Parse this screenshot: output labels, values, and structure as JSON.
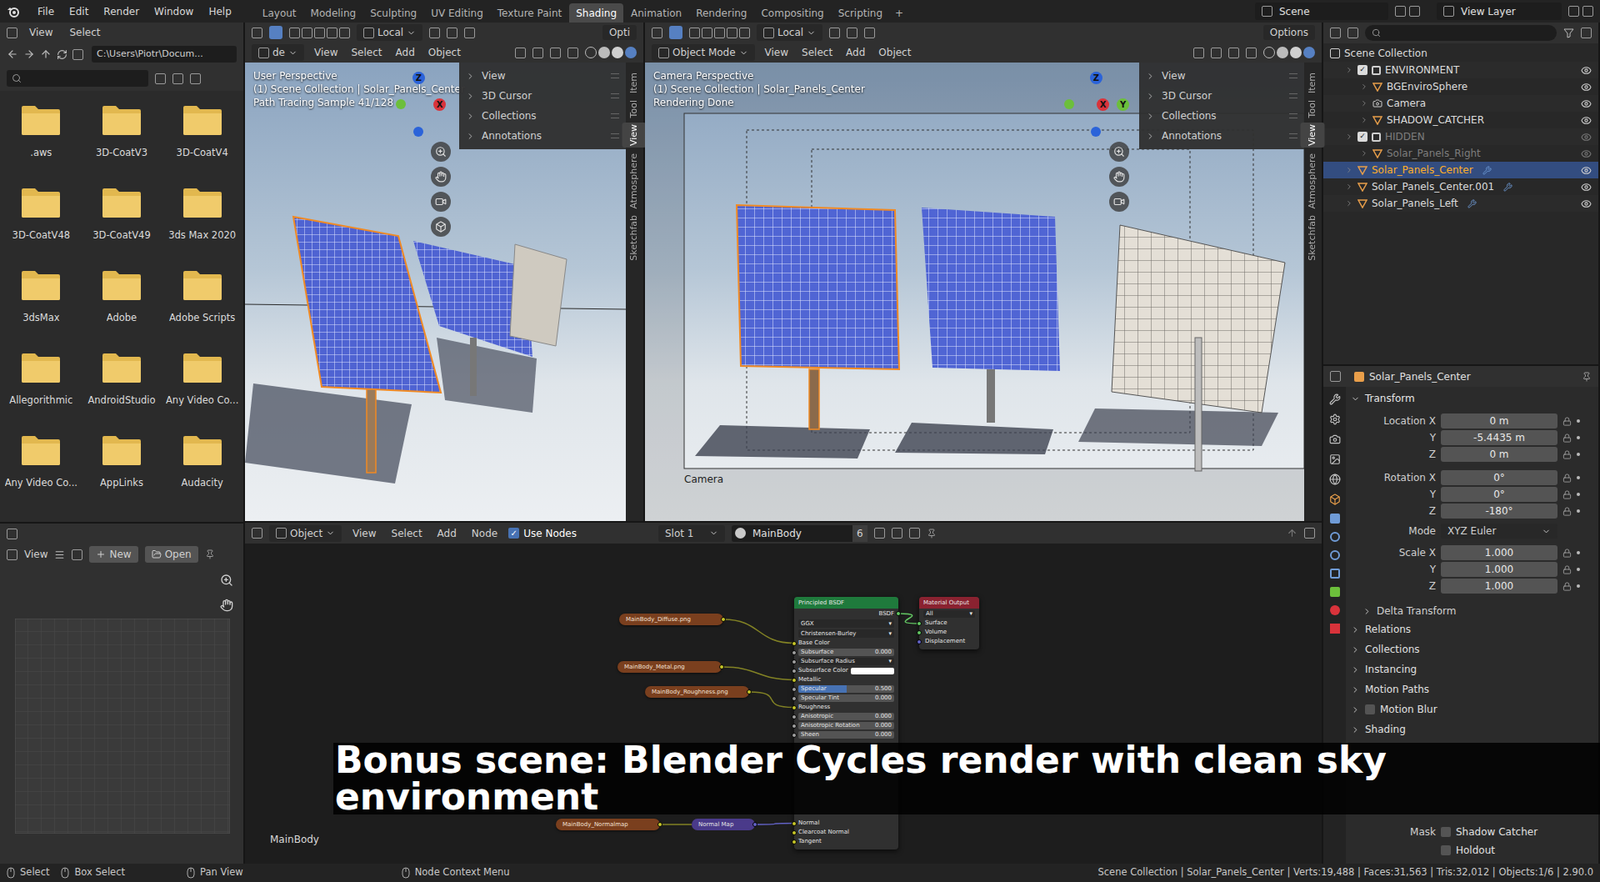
{
  "topbar": {
    "menus": [
      "File",
      "Edit",
      "Render",
      "Window",
      "Help"
    ],
    "workspaces": [
      {
        "label": "Layout",
        "selected": false
      },
      {
        "label": "Modeling",
        "selected": false
      },
      {
        "label": "Sculpting",
        "selected": false
      },
      {
        "label": "UV Editing",
        "selected": false
      },
      {
        "label": "Texture Paint",
        "selected": false
      },
      {
        "label": "Shading",
        "selected": true
      },
      {
        "label": "Animation",
        "selected": false
      },
      {
        "label": "Rendering",
        "selected": false
      },
      {
        "label": "Compositing",
        "selected": false
      },
      {
        "label": "Scripting",
        "selected": false
      }
    ],
    "add_tab": "+",
    "scene": "Scene",
    "view_layer": "View Layer"
  },
  "file_browser": {
    "menus": [
      "View",
      "Select"
    ],
    "path": "C:\\Users\\Piotr\\Docum...",
    "folders": [
      ".aws",
      "3D-CoatV3",
      "3D-CoatV4",
      "3D-CoatV48",
      "3D-CoatV49",
      "3ds Max 2020",
      "3dsMax",
      "Adobe",
      "Adobe Scripts",
      "Allegorithmic",
      "AndroidStudio",
      "Any Video Co...",
      "Any Video Co...",
      "AppLinks",
      "Audacity"
    ]
  },
  "image_editor": {
    "menus": [
      "View"
    ],
    "new": "New",
    "open": "Open"
  },
  "viewport_left": {
    "mode": "de",
    "menus": [
      "View",
      "Select",
      "Add",
      "Object"
    ],
    "orientation": "Local",
    "options": "Opti",
    "info": [
      "User Perspective",
      "(1) Scene Collection | Solar_Panels_Center",
      "Path Tracing Sample 41/128"
    ],
    "gizmo": [
      "Z",
      "X"
    ],
    "npanel": [
      "View",
      "3D Cursor",
      "Collections",
      "Annotations"
    ],
    "tabs": [
      {
        "label": "Item",
        "selected": false
      },
      {
        "label": "Tool",
        "selected": false
      },
      {
        "label": "View",
        "selected": true
      },
      {
        "label": "Atmosphere",
        "selected": false
      },
      {
        "label": "Sketchfab",
        "selected": false
      }
    ]
  },
  "viewport_right": {
    "mode": "Object Mode",
    "menus": [
      "View",
      "Select",
      "Add",
      "Object"
    ],
    "orientation": "Local",
    "options": "Options",
    "info": [
      "Camera Perspective",
      "(1) Scene Collection | Solar_Panels_Center",
      "Rendering Done"
    ],
    "gizmo": [
      "Z",
      "X",
      "Y"
    ],
    "npanel": [
      "View",
      "3D Cursor",
      "Collections",
      "Annotations"
    ],
    "tabs": [
      {
        "label": "Item",
        "selected": false
      },
      {
        "label": "Tool",
        "selected": false
      },
      {
        "label": "View",
        "selected": true
      },
      {
        "label": "Atmosphere",
        "selected": false
      },
      {
        "label": "Sketchfab",
        "selected": false
      }
    ],
    "camera_label": "Camera"
  },
  "node_editor": {
    "type": "Object",
    "menus": [
      "View",
      "Select",
      "Add",
      "Node"
    ],
    "use_nodes": {
      "label": "Use Nodes",
      "checked": true
    },
    "slot": "Slot 1",
    "material": "MainBody",
    "users": "6",
    "footer_label": "MainBody",
    "textures": [
      {
        "label": "MainBody_Diffuse.png",
        "link": "Base Color"
      },
      {
        "label": "MainBody_Metal.png",
        "link": "Metallic"
      },
      {
        "label": "MainBody_Roughness.png",
        "link": "Roughness"
      },
      {
        "label": "MainBody_Normalmap",
        "link": "Normal Map"
      }
    ],
    "normal_map": {
      "label": "Normal Map",
      "link": "Normal"
    },
    "principled": {
      "title": "Principled BSDF",
      "output": "BSDF",
      "dropdowns": [
        "GGX",
        "Christensen-Burley"
      ],
      "inputs_top": [
        {
          "label": "Base Color",
          "kind": "socket"
        },
        {
          "label": "Subsurface",
          "kind": "value",
          "value": "0.000",
          "level": 0
        },
        {
          "label": "Subsurface Radius",
          "kind": "dropdown"
        },
        {
          "label": "Subsurface Color",
          "kind": "color",
          "color": "#ffffff"
        },
        {
          "label": "Metallic",
          "kind": "socket"
        },
        {
          "label": "Specular",
          "kind": "value",
          "value": "0.500",
          "level": 0.5
        },
        {
          "label": "Specular Tint",
          "kind": "value",
          "value": "0.000",
          "level": 0
        },
        {
          "label": "Roughness",
          "kind": "socket"
        },
        {
          "label": "Anisotropic",
          "kind": "value",
          "value": "0.000",
          "level": 0
        },
        {
          "label": "Anisotropic Rotation",
          "kind": "value",
          "value": "0.000",
          "level": 0
        },
        {
          "label": "Sheen",
          "kind": "value",
          "value": "0.000",
          "level": 0
        }
      ],
      "inputs_bottom": [
        {
          "label": "Normal",
          "kind": "socket"
        },
        {
          "label": "Clearcoat Normal",
          "kind": "socket"
        },
        {
          "label": "Tangent",
          "kind": "socket"
        }
      ]
    },
    "output": {
      "title": "Material Output",
      "target": "All",
      "inputs": [
        "Surface",
        "Volume",
        "Displacement"
      ]
    }
  },
  "outliner": {
    "items": [
      {
        "label": "Scene Collection",
        "depth": 0,
        "kind": "scene",
        "selected": false,
        "greyed": false,
        "eye": false
      },
      {
        "label": "ENVIRONMENT",
        "depth": 1,
        "kind": "collection",
        "checked": true,
        "selected": false,
        "greyed": false,
        "eye": true
      },
      {
        "label": "BGEnviroSphere",
        "depth": 2,
        "kind": "mesh",
        "selected": false,
        "greyed": false,
        "eye": true
      },
      {
        "label": "Camera",
        "depth": 2,
        "kind": "camera",
        "selected": false,
        "greyed": false,
        "eye": true
      },
      {
        "label": "SHADOW_CATCHER",
        "depth": 2,
        "kind": "mesh",
        "selected": false,
        "greyed": false,
        "eye": true
      },
      {
        "label": "HIDDEN",
        "depth": 1,
        "kind": "collection",
        "checked": true,
        "selected": false,
        "greyed": true,
        "eye": true
      },
      {
        "label": "Solar_Panels_Right",
        "depth": 2,
        "kind": "mesh",
        "selected": false,
        "greyed": true,
        "eye": true
      },
      {
        "label": "Solar_Panels_Center",
        "depth": 1,
        "kind": "object",
        "selected": true,
        "greyed": false,
        "eye": true
      },
      {
        "label": "Solar_Panels_Center.001",
        "depth": 1,
        "kind": "object",
        "selected": false,
        "greyed": false,
        "eye": true
      },
      {
        "label": "Solar_Panels_Left",
        "depth": 1,
        "kind": "object",
        "selected": false,
        "greyed": false,
        "eye": true
      }
    ]
  },
  "properties": {
    "object": "Solar_Panels_Center",
    "panel": "Transform",
    "location": [
      {
        "label": "Location X",
        "value": "0 m"
      },
      {
        "label": "Y",
        "value": "-5.4435 m"
      },
      {
        "label": "Z",
        "value": "0 m"
      }
    ],
    "rotation": [
      {
        "label": "Rotation X",
        "value": "0°"
      },
      {
        "label": "Y",
        "value": "0°"
      },
      {
        "label": "Z",
        "value": "-180°"
      }
    ],
    "mode": {
      "label": "Mode",
      "value": "XYZ Euler"
    },
    "scale": [
      {
        "label": "Scale X",
        "value": "1.000"
      },
      {
        "label": "Y",
        "value": "1.000"
      },
      {
        "label": "Z",
        "value": "1.000"
      }
    ],
    "subpanel": "Delta Transform",
    "sections": [
      {
        "label": "Relations",
        "kind": "plain"
      },
      {
        "label": "Collections",
        "kind": "plain"
      },
      {
        "label": "Instancing",
        "kind": "plain"
      },
      {
        "label": "Motion Paths",
        "kind": "plain"
      },
      {
        "label": "Motion Blur",
        "kind": "checkbox",
        "checked": false
      },
      {
        "label": "Shading",
        "kind": "plain"
      }
    ],
    "mask": {
      "label": "Mask",
      "options": [
        {
          "label": "Shadow Catcher",
          "checked": false
        },
        {
          "label": "Holdout",
          "checked": false
        }
      ]
    }
  },
  "status_bar": {
    "items": [
      "Select",
      "Box Select",
      "Pan View",
      "Node Context Menu"
    ],
    "info": "Scene Collection | Solar_Panels_Center | Verts:19,488 | Faces:31,563 | Tris:32,012 | Objects:1/6 | 2.90.0"
  },
  "caption": "Bonus scene: Blender Cycles render with clean sky environment"
}
